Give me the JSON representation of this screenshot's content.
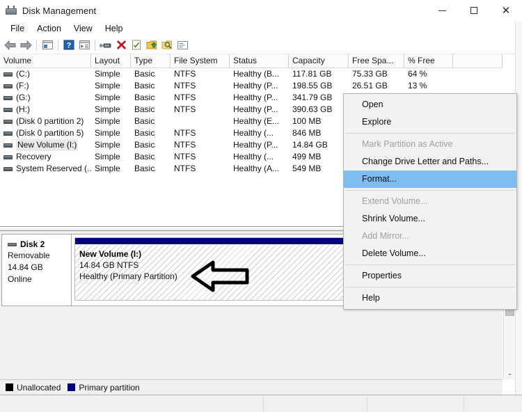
{
  "window": {
    "title": "Disk Management",
    "icon": "disk-management-icon",
    "controls": {
      "minimize": "–",
      "maximize": "□",
      "close": "✕"
    }
  },
  "menubar": {
    "items": [
      {
        "label": "File"
      },
      {
        "label": "Action"
      },
      {
        "label": "View"
      },
      {
        "label": "Help"
      }
    ]
  },
  "toolbar": {
    "buttons": [
      {
        "name": "back-icon"
      },
      {
        "name": "forward-icon"
      },
      {
        "name": "show-hide-console-tree-icon"
      },
      {
        "name": "help-icon"
      },
      {
        "name": "show-hide-action-pane-icon"
      },
      {
        "name": "rescan-disks-icon"
      },
      {
        "name": "delete-icon"
      },
      {
        "name": "properties-icon"
      },
      {
        "name": "extend-volume-icon"
      },
      {
        "name": "search-volume-icon"
      },
      {
        "name": "options-icon"
      }
    ]
  },
  "volume_table": {
    "columns": [
      {
        "key": "volume",
        "label": "Volume"
      },
      {
        "key": "layout",
        "label": "Layout"
      },
      {
        "key": "type",
        "label": "Type"
      },
      {
        "key": "file_system",
        "label": "File System"
      },
      {
        "key": "status",
        "label": "Status"
      },
      {
        "key": "capacity",
        "label": "Capacity"
      },
      {
        "key": "free_space",
        "label": "Free Spa..."
      },
      {
        "key": "pct_free",
        "label": "% Free"
      },
      {
        "key": "tail",
        "label": ""
      }
    ],
    "rows": [
      {
        "volume": "(C:)",
        "layout": "Simple",
        "type": "Basic",
        "file_system": "NTFS",
        "status": "Healthy (B...",
        "capacity": "117.81 GB",
        "free_space": "75.33 GB",
        "pct_free": "64 %",
        "selected": false
      },
      {
        "volume": "(F:)",
        "layout": "Simple",
        "type": "Basic",
        "file_system": "NTFS",
        "status": "Healthy (P...",
        "capacity": "198.55 GB",
        "free_space": "26.51 GB",
        "pct_free": "13 %",
        "selected": false
      },
      {
        "volume": "(G:)",
        "layout": "Simple",
        "type": "Basic",
        "file_system": "NTFS",
        "status": "Healthy (P...",
        "capacity": "341.79 GB",
        "free_space": "",
        "pct_free": "",
        "selected": false
      },
      {
        "volume": "(H:)",
        "layout": "Simple",
        "type": "Basic",
        "file_system": "NTFS",
        "status": "Healthy (P...",
        "capacity": "390.63 GB",
        "free_space": "",
        "pct_free": "",
        "selected": false
      },
      {
        "volume": "(Disk 0 partition 2)",
        "layout": "Simple",
        "type": "Basic",
        "file_system": "",
        "status": "Healthy (E...",
        "capacity": "100 MB",
        "free_space": "",
        "pct_free": "",
        "selected": false
      },
      {
        "volume": "(Disk 0 partition 5)",
        "layout": "Simple",
        "type": "Basic",
        "file_system": "NTFS",
        "status": "Healthy (...",
        "capacity": "846 MB",
        "free_space": "",
        "pct_free": "",
        "selected": false
      },
      {
        "volume": "New Volume (I:)",
        "layout": "Simple",
        "type": "Basic",
        "file_system": "NTFS",
        "status": "Healthy (P...",
        "capacity": "14.84 GB",
        "free_space": "",
        "pct_free": "",
        "selected": true
      },
      {
        "volume": "Recovery",
        "layout": "Simple",
        "type": "Basic",
        "file_system": "NTFS",
        "status": "Healthy (...",
        "capacity": "499 MB",
        "free_space": "",
        "pct_free": "",
        "selected": false
      },
      {
        "volume": "System Reserved (...",
        "layout": "Simple",
        "type": "Basic",
        "file_system": "NTFS",
        "status": "Healthy (A...",
        "capacity": "549 MB",
        "free_space": "",
        "pct_free": "",
        "selected": false
      }
    ]
  },
  "context_menu": {
    "items": [
      {
        "label": "Open",
        "state": "enabled"
      },
      {
        "label": "Explore",
        "state": "enabled"
      },
      {
        "type": "separator"
      },
      {
        "label": "Mark Partition as Active",
        "state": "disabled"
      },
      {
        "label": "Change Drive Letter and Paths...",
        "state": "enabled"
      },
      {
        "label": "Format...",
        "state": "highlighted"
      },
      {
        "type": "separator"
      },
      {
        "label": "Extend Volume...",
        "state": "disabled"
      },
      {
        "label": "Shrink Volume...",
        "state": "enabled"
      },
      {
        "label": "Add Mirror...",
        "state": "disabled"
      },
      {
        "label": "Delete Volume...",
        "state": "enabled"
      },
      {
        "type": "separator"
      },
      {
        "label": "Properties",
        "state": "enabled"
      },
      {
        "type": "separator"
      },
      {
        "label": "Help",
        "state": "enabled"
      }
    ],
    "highlight_color": "#7fbdf0"
  },
  "disk_pane": {
    "disk": {
      "name": "Disk 2",
      "media_type": "Removable",
      "size": "14.84 GB",
      "status": "Online"
    },
    "partition": {
      "name": "New Volume  (I:)",
      "size_fs": "14.84 GB NTFS",
      "health": "Healthy (Primary Partition)",
      "bar_color": "#000080"
    },
    "annotation": {
      "name": "pointer-arrow-annotation",
      "direction": "left"
    }
  },
  "legend": {
    "items": [
      {
        "label": "Unallocated",
        "color": "#000000"
      },
      {
        "label": "Primary partition",
        "color": "#000080"
      }
    ]
  },
  "scrollbar": {
    "down_arrow": "⌄"
  }
}
